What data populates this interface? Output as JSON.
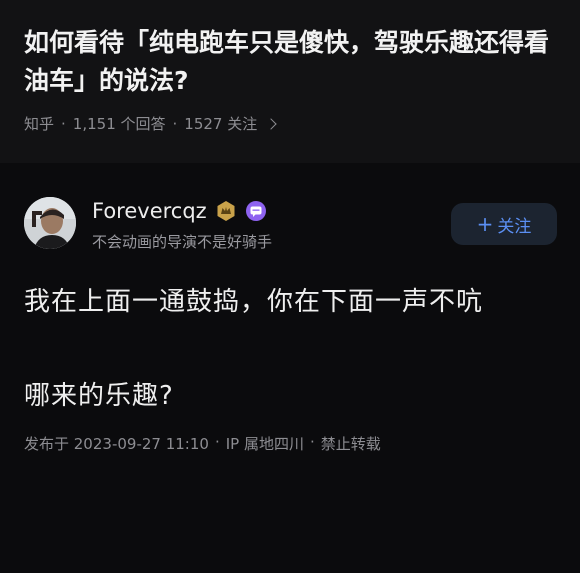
{
  "question": {
    "title": "如何看待「纯电跑车只是傻快，驾驶乐趣还得看油车」的说法?",
    "source": "知乎",
    "answers": "1,151 个回答",
    "followers": "1527 关注",
    "sep": "·"
  },
  "answer": {
    "author": "Forevercqz",
    "bio": "不会动画的导演不是好骑手",
    "follow_label": "关注",
    "follow_plus": "+",
    "text_line1": "我在上面一通鼓捣，你在下面一声不吭",
    "text_line2": "哪来的乐趣?",
    "published": "发布于 2023-09-27 11:10",
    "ip": "IP 属地四川",
    "copyright": "禁止转载",
    "sep": "·"
  },
  "colors": {
    "background": "#0b0b0d",
    "question_bg": "#121214",
    "accent": "#5b8ff3",
    "badge_gold": "#c9a24a",
    "badge_purple": "#8e63f0"
  },
  "icons": [
    "chevron-right-icon",
    "avatar",
    "gold-badge-icon",
    "purple-badge-icon",
    "plus-icon"
  ]
}
